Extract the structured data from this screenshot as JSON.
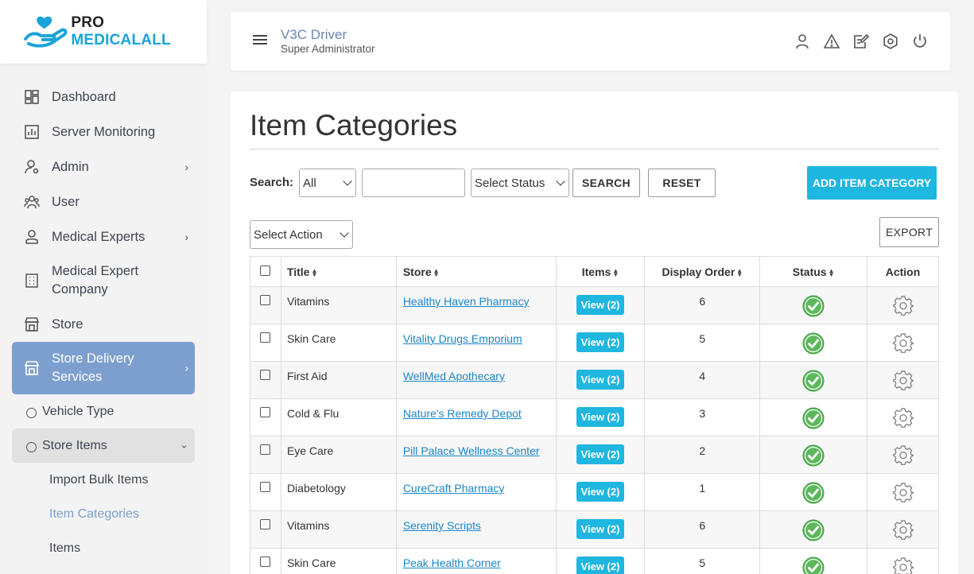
{
  "brand": {
    "pro": "PRO",
    "name": "MEDICALALL"
  },
  "sidebar": {
    "items": [
      {
        "label": "Dashboard",
        "icon": "dashboard-icon"
      },
      {
        "label": "Server Monitoring",
        "icon": "chart-icon"
      },
      {
        "label": "Admin",
        "icon": "admin-icon",
        "has_children": true
      },
      {
        "label": "User",
        "icon": "users-icon"
      },
      {
        "label": "Medical Experts",
        "icon": "person-icon",
        "has_children": true
      },
      {
        "label": "Medical Expert Company",
        "icon": "building-icon"
      },
      {
        "label": "Store",
        "icon": "store-icon"
      },
      {
        "label": "Store Delivery Services",
        "icon": "store-icon",
        "has_children": true,
        "active": true
      }
    ],
    "sub_items": [
      {
        "label": "Vehicle Type"
      },
      {
        "label": "Store Items",
        "open": true
      }
    ],
    "store_items_children": [
      {
        "label": "Import Bulk Items"
      },
      {
        "label": "Item Categories",
        "current": true
      },
      {
        "label": "Items"
      }
    ]
  },
  "header": {
    "user_name": "V3C Driver",
    "user_role": "Super Administrator",
    "icons": [
      "profile-icon",
      "alert-icon",
      "edit-note-icon",
      "settings-icon",
      "power-icon"
    ]
  },
  "page": {
    "title": "Item Categories",
    "search_label": "Search:",
    "search_field_select": "All",
    "search_input_value": "",
    "status_select": "Select Status",
    "search_button": "SEARCH",
    "reset_button": "RESET",
    "add_button": "ADD ITEM CATEGORY",
    "action_select": "Select Action",
    "export_button": "EXPORT"
  },
  "table": {
    "columns": [
      "Title",
      "Store",
      "Items",
      "Display Order",
      "Status",
      "Action"
    ],
    "rows": [
      {
        "title": "Vitamins",
        "store": "Healthy Haven Pharmacy",
        "items": "View (2)",
        "order": "6"
      },
      {
        "title": "Skin Care",
        "store": "Vitality Drugs Emporium",
        "items": "View (2)",
        "order": "5"
      },
      {
        "title": "First Aid",
        "store": "WellMed Apothecary",
        "items": "View (2)",
        "order": "4"
      },
      {
        "title": "Cold & Flu",
        "store": "Nature's Remedy Depot",
        "items": "View (2)",
        "order": "3"
      },
      {
        "title": "Eye Care",
        "store": "Pill Palace Wellness Center",
        "items": "View (2)",
        "order": "2"
      },
      {
        "title": "Diabetology",
        "store": "CureCraft Pharmacy",
        "items": "View (2)",
        "order": "1"
      },
      {
        "title": "Vitamins",
        "store": "Serenity Scripts",
        "items": "View (2)",
        "order": "6"
      },
      {
        "title": "Skin Care",
        "store": "Peak Health Corner",
        "items": "View (2)",
        "order": "5"
      }
    ]
  },
  "colors": {
    "accent": "#1fb6e0",
    "sidebar_active": "#7c9fcf",
    "status_active": "#5cb85c",
    "link": "#1a86c8"
  }
}
